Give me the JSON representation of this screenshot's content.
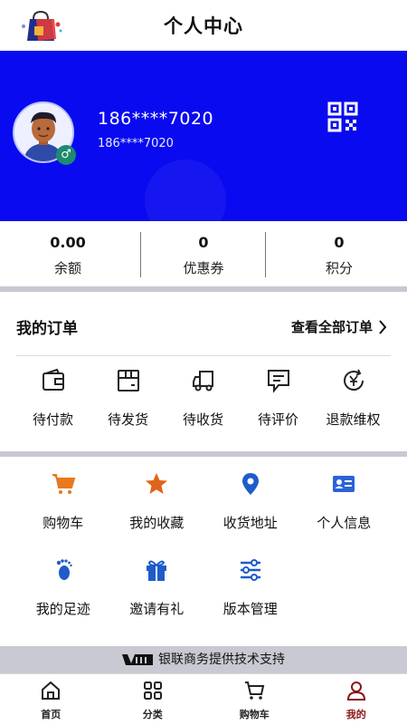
{
  "header": {
    "title": "个人中心",
    "logo_icon": "shopping-bag-logo"
  },
  "profile": {
    "phone": "186****7020",
    "phone_sub": "186****7020",
    "gender_symbol": "♂",
    "banner_color": "#0a0af0"
  },
  "stats": [
    {
      "value": "0.00",
      "label": "余额"
    },
    {
      "value": "0",
      "label": "优惠券"
    },
    {
      "value": "0",
      "label": "积分"
    }
  ],
  "orders": {
    "title": "我的订单",
    "view_all": "查看全部订单",
    "items": [
      {
        "label": "待付款",
        "icon": "wallet-icon"
      },
      {
        "label": "待发货",
        "icon": "package-icon"
      },
      {
        "label": "待收货",
        "icon": "truck-icon"
      },
      {
        "label": "待评价",
        "icon": "comment-icon"
      },
      {
        "label": "退款维权",
        "icon": "refund-icon"
      }
    ]
  },
  "services": [
    {
      "label": "购物车",
      "icon": "cart-icon",
      "color": "#e8791c"
    },
    {
      "label": "我的收藏",
      "icon": "star-icon",
      "color": "#e0641a"
    },
    {
      "label": "收货地址",
      "icon": "location-icon",
      "color": "#1f5cc9"
    },
    {
      "label": "个人信息",
      "icon": "id-card-icon",
      "color": "#2b63d6"
    },
    {
      "label": "我的足迹",
      "icon": "footprint-icon",
      "color": "#1f5cc9"
    },
    {
      "label": "邀请有礼",
      "icon": "gift-icon",
      "color": "#1f5cc9"
    },
    {
      "label": "版本管理",
      "icon": "sliders-icon",
      "color": "#1f5cc9"
    }
  ],
  "footer": {
    "support_text": "银联商务提供技术支持"
  },
  "bottom_nav": [
    {
      "label": "首页",
      "icon": "home-icon",
      "active": false
    },
    {
      "label": "分类",
      "icon": "grid-icon",
      "active": false
    },
    {
      "label": "购物车",
      "icon": "cart-icon",
      "active": false
    },
    {
      "label": "我的",
      "icon": "user-icon",
      "active": true
    }
  ],
  "colors": {
    "active_nav": "#8b1515",
    "separator": "#c8c8d4"
  }
}
